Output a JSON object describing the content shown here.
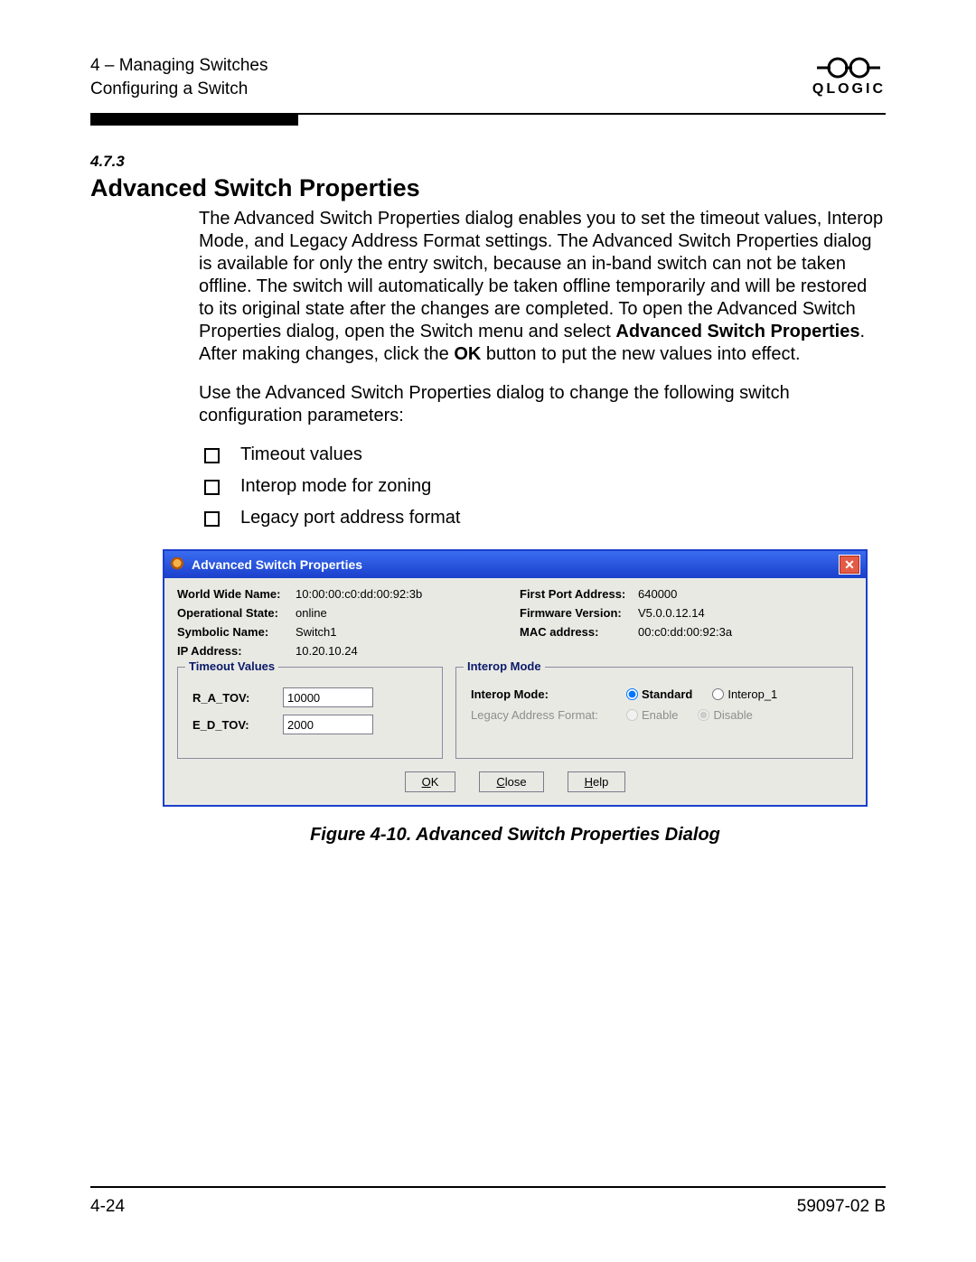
{
  "header": {
    "chapter_line": "4 – Managing Switches",
    "section_line": "Configuring a Switch",
    "brand": "QLOGIC"
  },
  "section": {
    "number": "4.7.3",
    "title": "Advanced Switch Properties",
    "para1_a": "The Advanced Switch Properties dialog enables you to set the timeout values, Interop Mode, and Legacy Address Format settings. The Advanced Switch Properties dialog is available for only the entry switch, because an in-band switch can not be taken offline. The switch will automatically be taken offline temporarily and will be restored to its original state after the changes are completed. To open the Advanced Switch Properties dialog, open the Switch menu and select ",
    "para1_bold": "Advanced Switch Properties",
    "para1_b": ". After making changes, click the ",
    "para1_bold2": "OK",
    "para1_c": " button to put the new values into effect.",
    "para2": "Use the Advanced Switch Properties dialog to change the following switch configuration parameters:",
    "bullets": [
      "Timeout values",
      "Interop mode for zoning",
      "Legacy port address format"
    ]
  },
  "dialog": {
    "title": "Advanced Switch Properties",
    "info": {
      "wwn_label": "World Wide Name:",
      "wwn_value": "10:00:00:c0:dd:00:92:3b",
      "first_port_label": "First Port Address:",
      "first_port_value": "640000",
      "op_state_label": "Operational State:",
      "op_state_value": "online",
      "fw_label": "Firmware Version:",
      "fw_value": "V5.0.0.12.14",
      "sym_label": "Symbolic Name:",
      "sym_value": "Switch1",
      "mac_label": "MAC address:",
      "mac_value": "00:c0:dd:00:92:3a",
      "ip_label": "IP Address:",
      "ip_value": "10.20.10.24"
    },
    "groups": {
      "timeout_legend": "Timeout Values",
      "ra_tov_label": "R_A_TOV:",
      "ra_tov_value": "10000",
      "ed_tov_label": "E_D_TOV:",
      "ed_tov_value": "2000",
      "interop_legend": "Interop Mode",
      "interop_label": "Interop Mode:",
      "interop_opt_standard": "Standard",
      "interop_opt_interop1": "Interop_1",
      "legacy_label": "Legacy Address Format:",
      "legacy_enable": "Enable",
      "legacy_disable": "Disable"
    },
    "buttons": {
      "ok": "OK",
      "close": "Close",
      "help": "Help"
    }
  },
  "figure_caption": "Figure 4-10.  Advanced Switch Properties Dialog",
  "footer": {
    "page": "4-24",
    "docid": "59097-02 B"
  }
}
